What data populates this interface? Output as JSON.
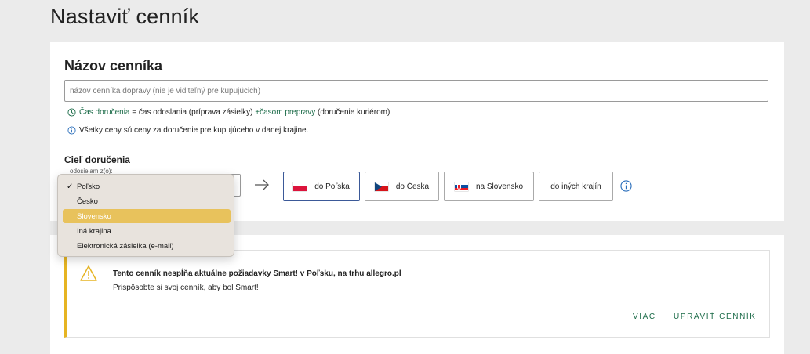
{
  "page": {
    "title": "Nastaviť cenník"
  },
  "pricelist": {
    "section_title": "Názov cenníka",
    "name_input": {
      "value": "",
      "placeholder": "názov cenníka dopravy (nie je viditeľný pre kupujúcich)"
    },
    "delivery_note": {
      "part1": "Čas doručenia",
      "part2": " = čas odoslania (príprava zásielky) ",
      "part3": "+časom prepravy",
      "part4": " (doručenie kuriérom)"
    },
    "prices_note": "Všetky ceny sú ceny za doručenie pre kupujúceho v danej krajine."
  },
  "destination": {
    "label": "Cieľ doručenia",
    "from_legend": "odosielam z(o):",
    "buttons": [
      {
        "label": "do Poľska",
        "flag": "poland",
        "active": true
      },
      {
        "label": "do Česka",
        "flag": "czechia",
        "active": false
      },
      {
        "label": "na Slovensko",
        "flag": "slovakia",
        "active": false
      },
      {
        "label": "do iných krajín",
        "flag": "",
        "active": false
      }
    ],
    "info_icon": "info-circle-icon"
  },
  "dropdown": {
    "selected": "Poľsko",
    "options": [
      "Poľsko",
      "Česko",
      "Slovensko",
      "Iná krajina",
      "Elektronická zásielka (e-mail)"
    ],
    "highlighted": "Slovensko"
  },
  "warning": {
    "title": "Tento cenník nespĺňa aktuálne požiadavky Smart! v Poľsku, na trhu allegro.pl",
    "subtitle": "Prispôsobte si svoj cenník, aby bol Smart!",
    "more_label": "VIAC",
    "edit_label": "UPRAVIŤ CENNÍK"
  },
  "colors": {
    "accent_green": "#1b6b48",
    "warning_yellow": "#e6b422",
    "active_border": "#3b5998",
    "highlight": "#e8c25c"
  }
}
